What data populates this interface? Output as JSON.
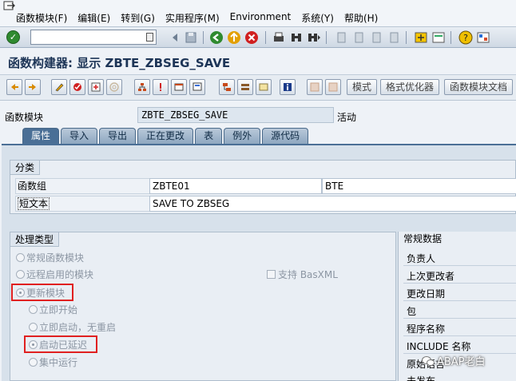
{
  "menu": {
    "items": [
      "函数模块(F)",
      "编辑(E)",
      "转到(G)",
      "实用程序(M)",
      "Environment",
      "系统(Y)",
      "帮助(H)"
    ]
  },
  "title": "函数构建器: 显示 ZBTE_ZBSEG_SAVE",
  "app_toolbar": {
    "buttons": [
      "模式",
      "格式优化器",
      "函数模块文档"
    ]
  },
  "header": {
    "fm_label": "函数模块",
    "fm_value": "ZBTE_ZBSEG_SAVE",
    "status": "活动"
  },
  "tabs": [
    "属性",
    "导入",
    "导出",
    "正在更改",
    "表",
    "例外",
    "源代码"
  ],
  "classification": {
    "title": "分类",
    "group_label": "函数组",
    "group_value": "ZBTE01",
    "group_desc": "BTE",
    "short_label": "短文本",
    "short_value": "SAVE TO ZBSEG"
  },
  "processing": {
    "title": "处理类型",
    "normal": "常规函数模块",
    "remote": "远程启用的模块",
    "basxml": "支持 BasXML",
    "update": "更新模块",
    "immediate": "立即开始",
    "immediate_no_restart": "立即启动，无重启",
    "delayed": "启动已延迟",
    "collective": "集中运行"
  },
  "general": {
    "title": "常规数据",
    "items": [
      "负责人",
      "上次更改者",
      "更改日期",
      "包",
      "程序名称",
      "INCLUDE 名称",
      "原始语言",
      "未发布"
    ]
  },
  "watermark": "ABAP老白",
  "colors": {
    "accent": "#4a6f96",
    "highlight": "#e02020",
    "title": "#1d3557"
  }
}
